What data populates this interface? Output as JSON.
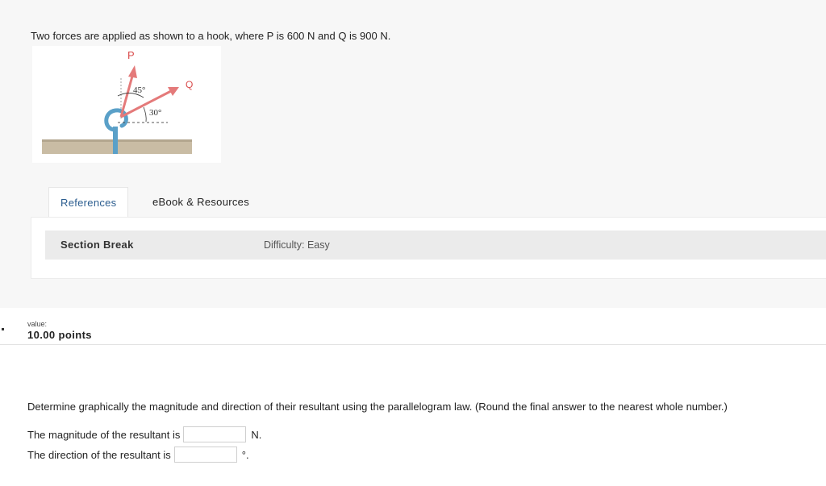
{
  "problem": {
    "text": "Two forces are applied as shown to a hook, where P is 600 N and Q is 900 N."
  },
  "figure": {
    "label_p": "P",
    "label_q": "Q",
    "angle_1": "45°",
    "angle_2": "30°",
    "colors": {
      "force_arrow": "#e47a7a",
      "hook": "#5aa0c8",
      "ground": "#c9bca4",
      "label": "#d94c4c"
    }
  },
  "tabs": {
    "references": "References",
    "ebook": "eBook & Resources"
  },
  "section": {
    "label": "Section Break",
    "difficulty": "Difficulty: Easy"
  },
  "value": {
    "label": "value:",
    "points": "10.00 points"
  },
  "question": {
    "text": "Determine graphically the magnitude and direction of their resultant using the parallelogram law. (Round the final answer to the nearest whole number.)",
    "magnitude_label": "The magnitude of the resultant is",
    "magnitude_value": "",
    "magnitude_unit": "N.",
    "direction_label": "The direction of the resultant is",
    "direction_value": "",
    "direction_unit": "°."
  }
}
